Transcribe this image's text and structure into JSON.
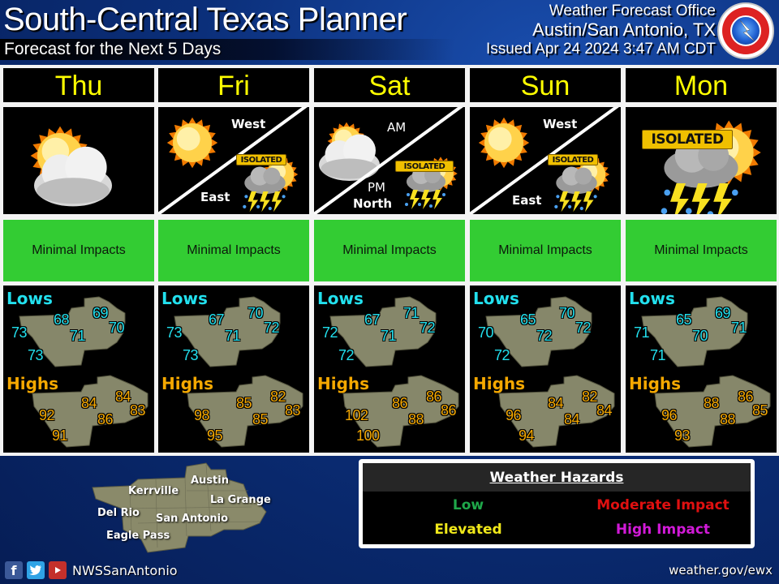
{
  "header": {
    "title": "South-Central Texas Planner",
    "subtitle": "Forecast for the Next 5 Days",
    "office_line1": "Weather Forecast Office",
    "office_line2": "Austin/San Antonio, TX",
    "issued": "Issued Apr 24 2024 3:47 AM CDT",
    "logo": "nws-logo"
  },
  "days": [
    {
      "name": "Thu",
      "icon": "mostly-cloudy",
      "icon_labels": {},
      "impact": "Minimal Impacts",
      "lows": {
        "label": "Lows",
        "values": [
          "73",
          "68",
          "69",
          "70",
          "71",
          "73"
        ]
      },
      "highs": {
        "label": "Highs",
        "values": [
          "92",
          "84",
          "84",
          "83",
          "86",
          "91"
        ]
      }
    },
    {
      "name": "Fri",
      "icon": "split-sunny-isolated-storms",
      "icon_labels": {
        "top": "West",
        "bottom": "East",
        "tag": "ISOLATED"
      },
      "impact": "Minimal Impacts",
      "lows": {
        "label": "Lows",
        "values": [
          "73",
          "67",
          "70",
          "72",
          "71",
          "73"
        ]
      },
      "highs": {
        "label": "Highs",
        "values": [
          "98",
          "85",
          "82",
          "83",
          "85",
          "95"
        ]
      }
    },
    {
      "name": "Sat",
      "icon": "split-cloudy-isolated-storms",
      "icon_labels": {
        "top": "AM",
        "bottom": "PM",
        "bottom2": "North",
        "tag": "ISOLATED"
      },
      "impact": "Minimal Impacts",
      "lows": {
        "label": "Lows",
        "values": [
          "72",
          "67",
          "71",
          "72",
          "71",
          "72"
        ]
      },
      "highs": {
        "label": "Highs",
        "values": [
          "102",
          "86",
          "86",
          "86",
          "88",
          "100"
        ]
      }
    },
    {
      "name": "Sun",
      "icon": "split-sunny-isolated-storms",
      "icon_labels": {
        "top": "West",
        "bottom": "East",
        "tag": "ISOLATED"
      },
      "impact": "Minimal Impacts",
      "lows": {
        "label": "Lows",
        "values": [
          "70",
          "65",
          "70",
          "72",
          "72",
          "72"
        ]
      },
      "highs": {
        "label": "Highs",
        "values": [
          "96",
          "84",
          "82",
          "84",
          "84",
          "94"
        ]
      }
    },
    {
      "name": "Mon",
      "icon": "isolated-storms",
      "icon_labels": {
        "tag": "ISOLATED"
      },
      "impact": "Minimal Impacts",
      "lows": {
        "label": "Lows",
        "values": [
          "71",
          "65",
          "69",
          "71",
          "70",
          "71"
        ]
      },
      "highs": {
        "label": "Highs",
        "values": [
          "96",
          "88",
          "86",
          "85",
          "88",
          "93"
        ]
      }
    }
  ],
  "impact_color": "#33cc33",
  "reference_map": {
    "cities": [
      "Austin",
      "Kerrville",
      "La Grange",
      "Del Rio",
      "San Antonio",
      "Eagle Pass"
    ]
  },
  "social": {
    "icons": [
      "facebook-icon",
      "twitter-icon",
      "youtube-icon"
    ],
    "handle": "NWSSanAntonio"
  },
  "website": "weather.gov/ewx",
  "hazards_legend": {
    "title": "Weather Hazards",
    "items": [
      {
        "label": "Low",
        "color": "#1fa84a"
      },
      {
        "label": "Moderate Impact",
        "color": "#e01010"
      },
      {
        "label": "Elevated",
        "color": "#f0e81a"
      },
      {
        "label": "High Impact",
        "color": "#d21ad8"
      }
    ]
  }
}
